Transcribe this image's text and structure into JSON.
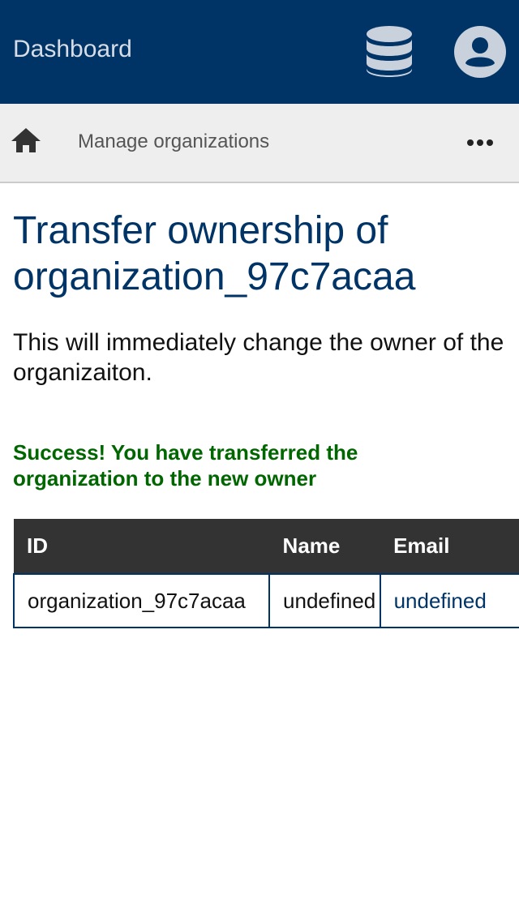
{
  "header": {
    "title": "Dashboard",
    "database_icon": "database-icon",
    "account_icon": "account-circle-icon",
    "background_color": "#003366"
  },
  "nav": {
    "home_icon": "home-icon",
    "link_label": "Manage organizations",
    "more_icon": "more-horizontal-icon"
  },
  "main": {
    "title": "Transfer ownership of organization_97c7acaa",
    "description": "This will immediately change the owner of the organizaiton.",
    "success_message": "Success! You have transferred the organization to the new owner",
    "success_color": "#006600",
    "table": {
      "columns": [
        "ID",
        "Name",
        "Email"
      ],
      "rows": [
        [
          "organization_97c7acaa",
          "undefined",
          "undefined"
        ]
      ]
    }
  }
}
